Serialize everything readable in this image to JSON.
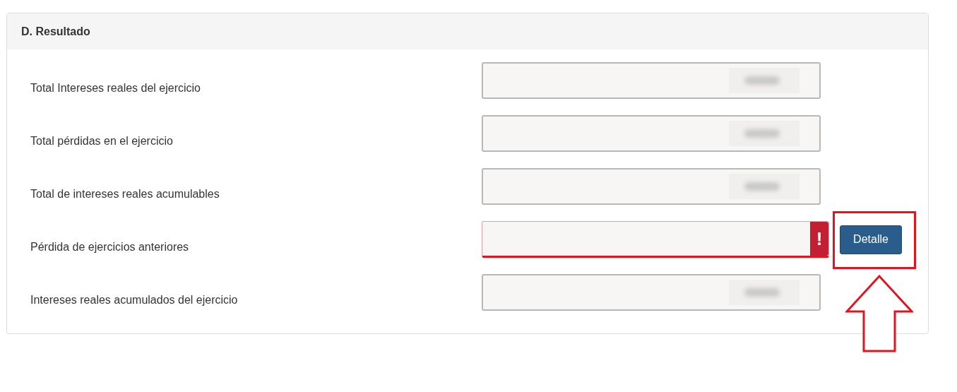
{
  "panel": {
    "title": "D. Resultado"
  },
  "rows": [
    {
      "label": "Total Intereses reales del ejercicio",
      "kind": "readonly",
      "error": false
    },
    {
      "label": "Total pérdidas en el ejercicio",
      "kind": "readonly",
      "error": false
    },
    {
      "label": "Total de intereses reales acumulables",
      "kind": "readonly",
      "error": false
    },
    {
      "label": "Pérdida de ejercicios anteriores",
      "kind": "input",
      "error": true,
      "error_mark": "!",
      "button": "Detalle"
    },
    {
      "label": "Intereses reales acumulados del ejercicio",
      "kind": "readonly",
      "error": false
    }
  ]
}
